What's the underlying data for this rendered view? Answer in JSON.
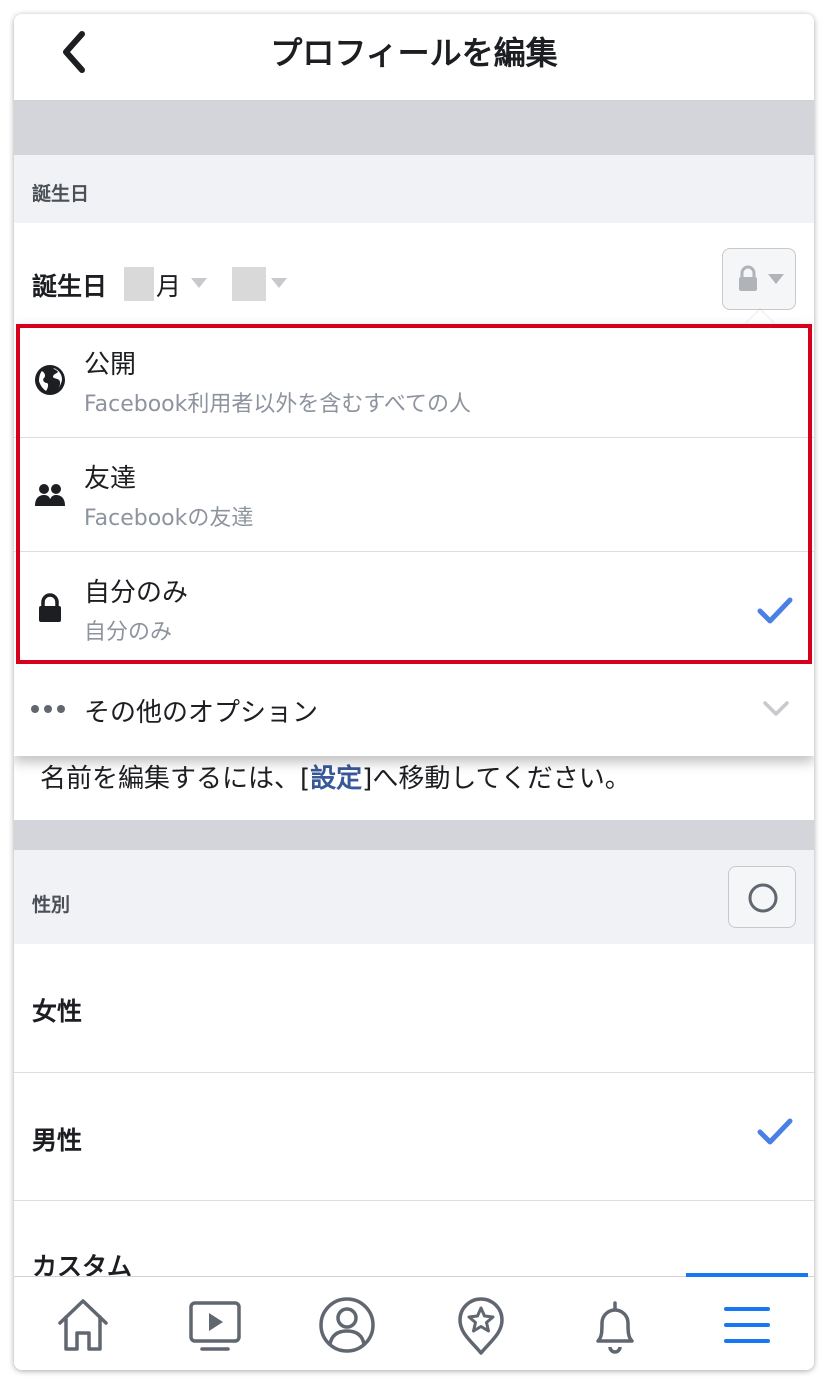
{
  "header": {
    "title": "プロフィールを編集"
  },
  "birthday_section": {
    "section_label": "誕生日",
    "field_label": "誕生日",
    "month_suffix": "月"
  },
  "privacy_menu": {
    "options": [
      {
        "title": "公開",
        "subtitle": "Facebook利用者以外を含むすべての人",
        "icon": "globe-icon",
        "selected": false
      },
      {
        "title": "友達",
        "subtitle": "Facebookの友達",
        "icon": "friends-icon",
        "selected": false
      },
      {
        "title": "自分のみ",
        "subtitle": "自分のみ",
        "icon": "lock-icon",
        "selected": true
      }
    ],
    "more_options_label": "その他のオプション"
  },
  "name_note": {
    "prefix": "名前を編集するには、[",
    "link": "設定",
    "suffix": "]へ移動してください。"
  },
  "gender_section": {
    "section_label": "性別",
    "options": [
      {
        "label": "女性",
        "selected": false
      },
      {
        "label": "男性",
        "selected": true
      },
      {
        "label": "カスタム",
        "selected": false
      }
    ]
  },
  "tabbar": {
    "tabs": [
      {
        "icon": "home-icon"
      },
      {
        "icon": "video-icon"
      },
      {
        "icon": "profile-icon"
      },
      {
        "icon": "pin-star-icon"
      },
      {
        "icon": "bell-icon"
      },
      {
        "icon": "menu-icon",
        "active": true
      }
    ]
  },
  "colors": {
    "accent": "#1877f2",
    "check": "#4a7fe6",
    "highlight_box": "#d6001c"
  }
}
